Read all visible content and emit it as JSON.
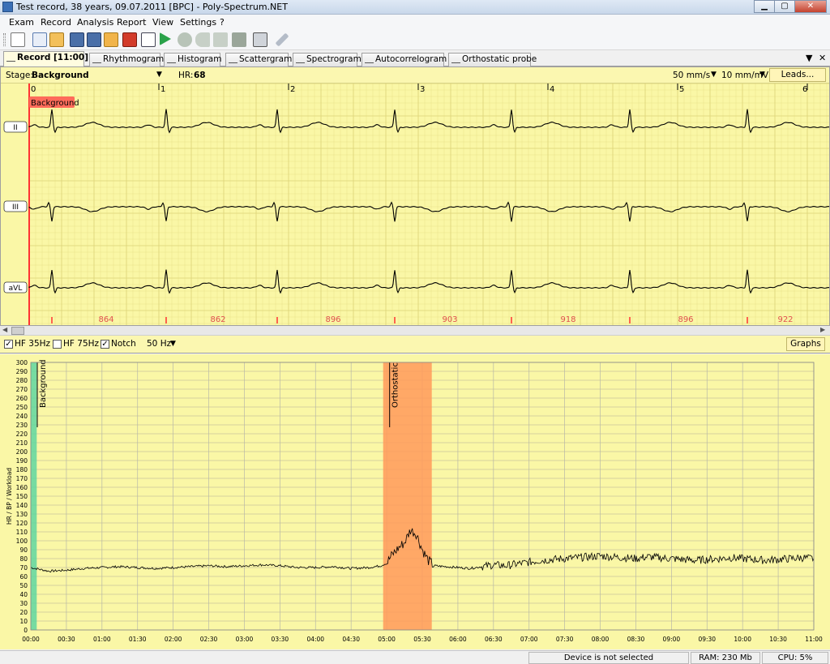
{
  "window": {
    "title": "Test record, 38 years, 09.07.2011 [BPC] - Poly-Spectrum.NET"
  },
  "menu": [
    "Exam",
    "Record",
    "Analysis",
    "Report",
    "View",
    "Settings",
    "?"
  ],
  "toolbar": {
    "icons": [
      "exam-list-icon",
      "new-exam-icon",
      "open-exam-icon",
      "save-icon",
      "save-all-icon",
      "export-icon",
      "delete-exam-icon",
      "report-icon",
      "play-icon",
      "record-icon",
      "undo-icon",
      "fast-forward-icon",
      "stop-icon",
      "print-icon",
      "settings-wrench-icon"
    ]
  },
  "tabs": [
    {
      "label": "Record [11:00]",
      "icon": "ecg-icon",
      "active": true
    },
    {
      "label": "Rhythmogram",
      "icon": "rhythmogram-icon",
      "active": false
    },
    {
      "label": "Histogram",
      "icon": "histogram-icon",
      "active": false
    },
    {
      "label": "Scattergram",
      "icon": "scattergram-icon",
      "active": false
    },
    {
      "label": "Spectrogram",
      "icon": "spectrogram-icon",
      "active": false
    },
    {
      "label": "Autocorrelogram",
      "icon": "autocorrelogram-icon",
      "active": false
    },
    {
      "label": "Orthostatic probe",
      "icon": "orthostatic-icon",
      "active": false
    }
  ],
  "tab_controls": {
    "dropdown": "▼",
    "close": "✕"
  },
  "ecg": {
    "stage_label": "Stage:",
    "stage_value": "Background",
    "hr_label": "HR:",
    "hr_value": "68",
    "speed": "50 mm/s",
    "gain": "10 mm/mV",
    "leads_button": "Leads...",
    "stage_marker": "Background",
    "seconds": [
      "0",
      "1",
      "2",
      "3",
      "4",
      "5",
      "6"
    ],
    "leads": [
      "II",
      "III",
      "aVL"
    ],
    "rr_intervals": [
      "864",
      "862",
      "896",
      "903",
      "918",
      "896",
      "922"
    ],
    "colors": {
      "paper": "#faf7a6",
      "grid": "#e9e18a",
      "trace": "#000000",
      "marker": "#ff3333",
      "rr": "#e05050"
    }
  },
  "filters": {
    "hf35": {
      "label": "HF 35Hz",
      "checked": true
    },
    "hf75": {
      "label": "HF 75Hz",
      "checked": false
    },
    "notch": {
      "label": "Notch",
      "checked": true
    },
    "notch_freq": "50 Hz",
    "graphs_button": "Graphs"
  },
  "chart_data": {
    "type": "line",
    "title": "",
    "xlabel": "",
    "ylabel": "HR / BP / Workload",
    "ylim": [
      0,
      300
    ],
    "y_ticks": [
      0,
      10,
      20,
      30,
      40,
      50,
      60,
      70,
      80,
      90,
      100,
      110,
      120,
      130,
      140,
      150,
      160,
      170,
      180,
      190,
      200,
      210,
      220,
      230,
      240,
      250,
      260,
      270,
      280,
      290,
      300
    ],
    "x_tick_labels": [
      "00:00",
      "00:30",
      "01:00",
      "01:30",
      "02:00",
      "02:30",
      "03:00",
      "03:30",
      "04:00",
      "04:30",
      "05:00",
      "05:30",
      "06:00",
      "06:30",
      "07:00",
      "07:30",
      "08:00",
      "08:30",
      "09:00",
      "09:30",
      "10:00",
      "10:30",
      "11:00"
    ],
    "grid": true,
    "stages": [
      {
        "label": "Background",
        "start_sec": 0,
        "end_sec": 5,
        "color": "#5fd6a0"
      },
      {
        "label": "Orthostatic",
        "start_sec": 297,
        "end_sec": 338,
        "color": "#ff9a5a"
      }
    ],
    "series": [
      {
        "color": "#000000",
        "x_sec": [
          0,
          15,
          30,
          45,
          60,
          75,
          90,
          105,
          120,
          135,
          150,
          165,
          180,
          195,
          210,
          225,
          240,
          255,
          270,
          285,
          295,
          300,
          305,
          310,
          315,
          320,
          325,
          330,
          335,
          340,
          350,
          360,
          370,
          380,
          390,
          400,
          410,
          420,
          430,
          440,
          450,
          460,
          470,
          480,
          490,
          500,
          510,
          520,
          530,
          540,
          550,
          560,
          570,
          580,
          590,
          600,
          610,
          620,
          630,
          640,
          650,
          660
        ],
        "hr": [
          70,
          66,
          67,
          69,
          70,
          71,
          70,
          69,
          70,
          71,
          72,
          71,
          72,
          73,
          72,
          70,
          70,
          71,
          69,
          70,
          72,
          75,
          85,
          92,
          98,
          112,
          108,
          90,
          78,
          72,
          71,
          70,
          69,
          71,
          73,
          72,
          74,
          76,
          78,
          79,
          80,
          81,
          82,
          83,
          82,
          81,
          80,
          82,
          81,
          80,
          79,
          78,
          79,
          80,
          81,
          80,
          79,
          78,
          79,
          80,
          81,
          80
        ]
      }
    ]
  },
  "status": {
    "device": "Device is not selected",
    "ram": "RAM: 230 Mb",
    "cpu": "CPU: 5%"
  }
}
